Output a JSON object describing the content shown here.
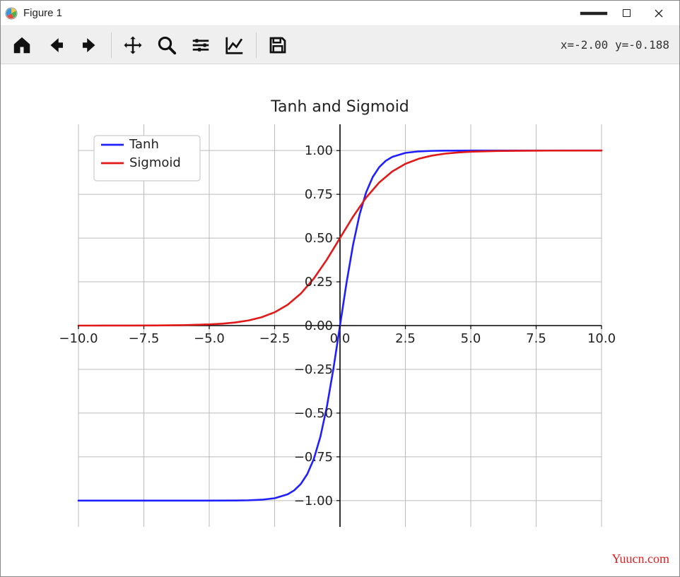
{
  "window": {
    "title": "Figure 1"
  },
  "toolbar": {
    "coord_text": "x=-2.00 y=-0.188"
  },
  "watermark": "Yuucn.com",
  "chart_data": {
    "type": "line",
    "title": "Tanh and Sigmoid",
    "xlabel": "",
    "ylabel": "",
    "xlim": [
      -10,
      10
    ],
    "ylim": [
      -1.15,
      1.15
    ],
    "xticks": [
      -10.0,
      -7.5,
      -5.0,
      -2.5,
      0.0,
      2.5,
      5.0,
      7.5,
      10.0
    ],
    "yticks": [
      -1.0,
      -0.75,
      -0.5,
      -0.25,
      0.0,
      0.25,
      0.5,
      0.75,
      1.0
    ],
    "xtick_labels": [
      "−10.0",
      "−7.5",
      "−5.0",
      "−2.5",
      "0.0",
      "2.5",
      "5.0",
      "7.5",
      "10.0"
    ],
    "ytick_labels": [
      "−1.00",
      "−0.75",
      "−0.50",
      "−0.25",
      "0.00",
      "0.25",
      "0.50",
      "0.75",
      "1.00"
    ],
    "grid": true,
    "legend_position": "upper left",
    "series": [
      {
        "name": "Tanh",
        "color": "#1f1fff",
        "x": [
          -10,
          -9,
          -8,
          -7,
          -6,
          -5,
          -4,
          -3.5,
          -3,
          -2.5,
          -2,
          -1.75,
          -1.5,
          -1.25,
          -1,
          -0.75,
          -0.5,
          -0.25,
          0,
          0.25,
          0.5,
          0.75,
          1,
          1.25,
          1.5,
          1.75,
          2,
          2.5,
          3,
          3.5,
          4,
          5,
          6,
          7,
          8,
          9,
          10
        ],
        "y": [
          -1.0,
          -1.0,
          -1.0,
          -1.0,
          -1.0,
          -0.9999,
          -0.9993,
          -0.9982,
          -0.9951,
          -0.9866,
          -0.964,
          -0.9414,
          -0.9051,
          -0.8483,
          -0.7616,
          -0.6351,
          -0.4621,
          -0.2449,
          0.0,
          0.2449,
          0.4621,
          0.6351,
          0.7616,
          0.8483,
          0.9051,
          0.9414,
          0.964,
          0.9866,
          0.9951,
          0.9982,
          0.9993,
          0.9999,
          1.0,
          1.0,
          1.0,
          1.0,
          1.0
        ]
      },
      {
        "name": "Sigmoid",
        "color": "#e11919",
        "x": [
          -10,
          -9,
          -8,
          -7,
          -6,
          -5,
          -4.5,
          -4,
          -3.5,
          -3,
          -2.5,
          -2,
          -1.5,
          -1,
          -0.5,
          0,
          0.5,
          1,
          1.5,
          2,
          2.5,
          3,
          3.5,
          4,
          4.5,
          5,
          6,
          7,
          8,
          9,
          10
        ],
        "y": [
          0.0,
          0.0001,
          0.0003,
          0.0009,
          0.0025,
          0.0067,
          0.011,
          0.018,
          0.0293,
          0.0474,
          0.0759,
          0.1192,
          0.1824,
          0.2689,
          0.3775,
          0.5,
          0.6225,
          0.7311,
          0.8176,
          0.8808,
          0.9241,
          0.9526,
          0.9707,
          0.982,
          0.989,
          0.9933,
          0.9975,
          0.9991,
          0.9997,
          0.9999,
          1.0
        ]
      }
    ]
  }
}
